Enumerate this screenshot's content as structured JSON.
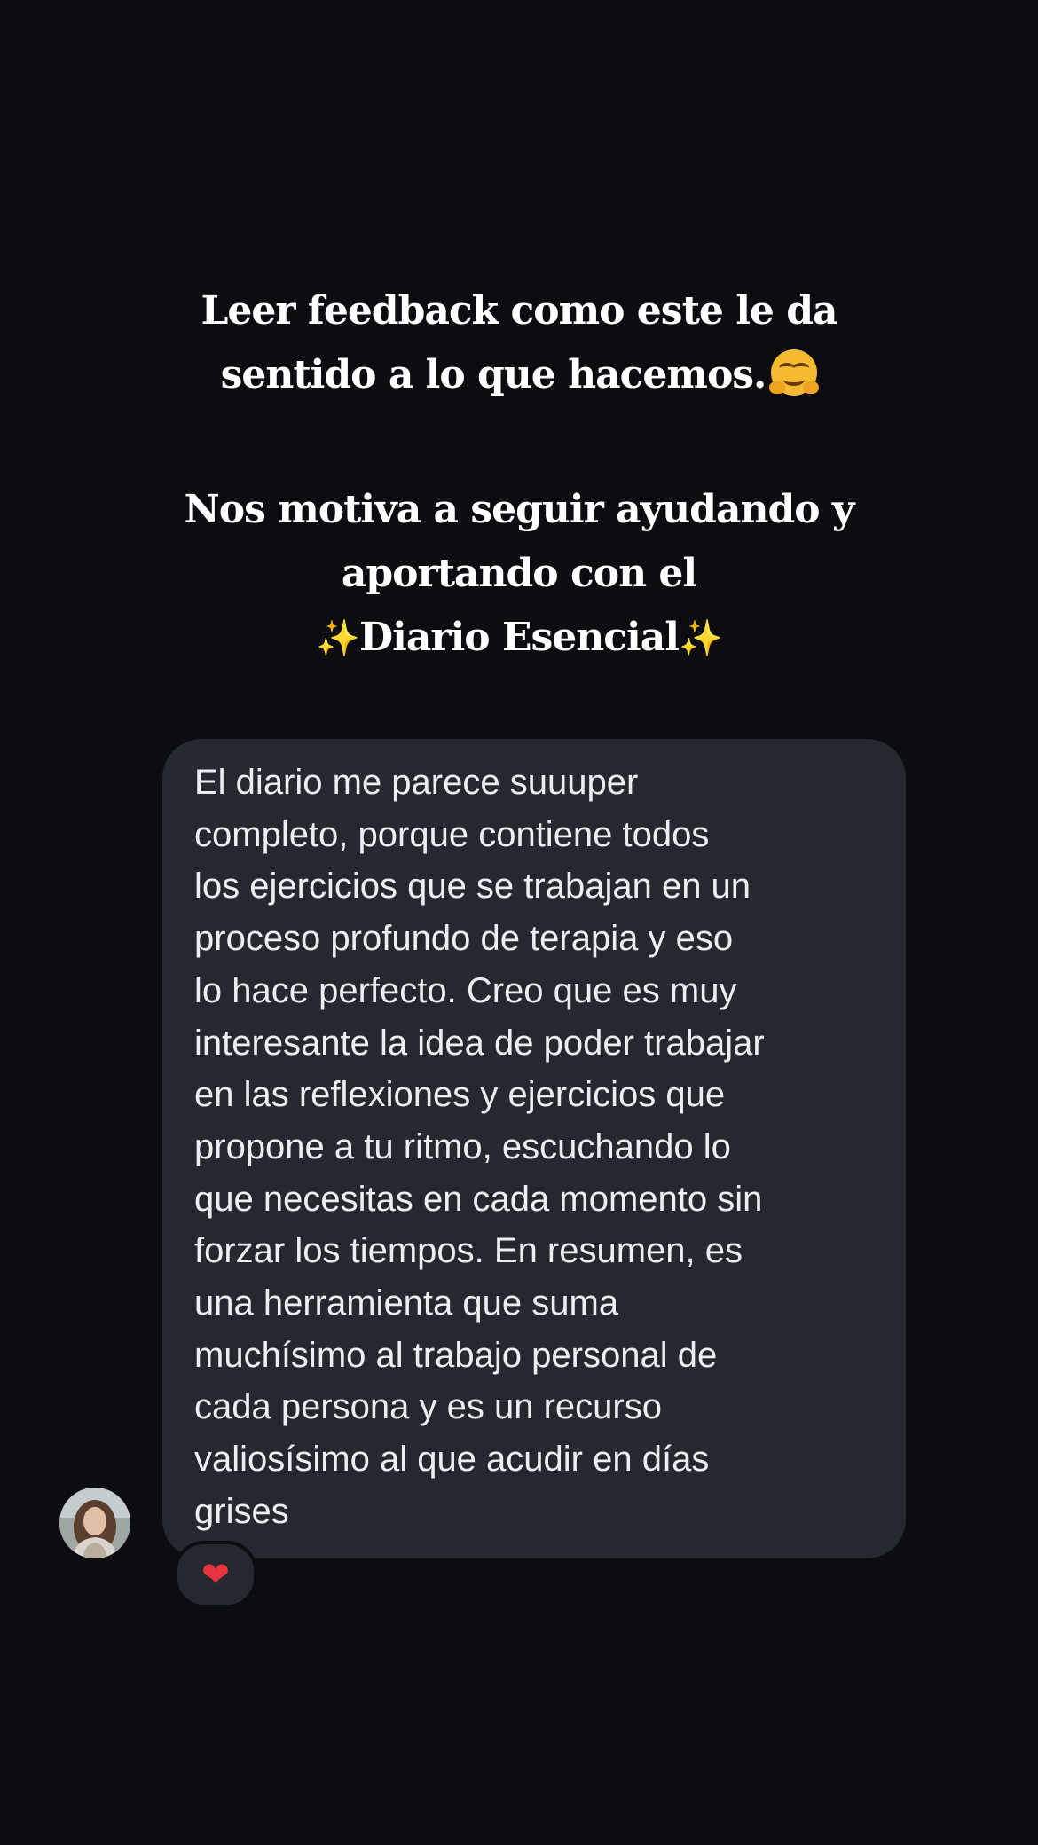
{
  "caption": {
    "line1": "Leer feedback como este le da",
    "line2": "sentido a lo que hacemos.",
    "line2_emoji": "hugging-face-emoji",
    "line3": "Nos motiva a seguir ayudando y",
    "line4": "aportando con el",
    "line5_sparkle_left": "✨",
    "line5": "Diario Esencial",
    "line5_sparkle_right": "✨"
  },
  "message": {
    "text": "El diario me parece suuuper\ncompleto, porque contiene todos\nlos ejercicios que se trabajan en un\nproceso profundo de terapia y eso\nlo hace perfecto. Creo que es muy\ninteresante la idea de poder trabajar\nen las reflexiones y ejercicios que\npropone a tu ritmo, escuchando lo\nque necesitas en cada momento sin\nforzar los tiempos. En resumen, es\nuna herramienta que suma\nmuchísimo al trabajo personal de\ncada persona y es un recurso\nvaliosísimo al que acudir en días\ngrises",
    "reaction": "❤",
    "sender_avatar": "sender-avatar-photo"
  },
  "colors": {
    "background": "#0b0d10",
    "bubble": "#25282e",
    "text": "#eceef1",
    "heart": "#e8343f"
  }
}
